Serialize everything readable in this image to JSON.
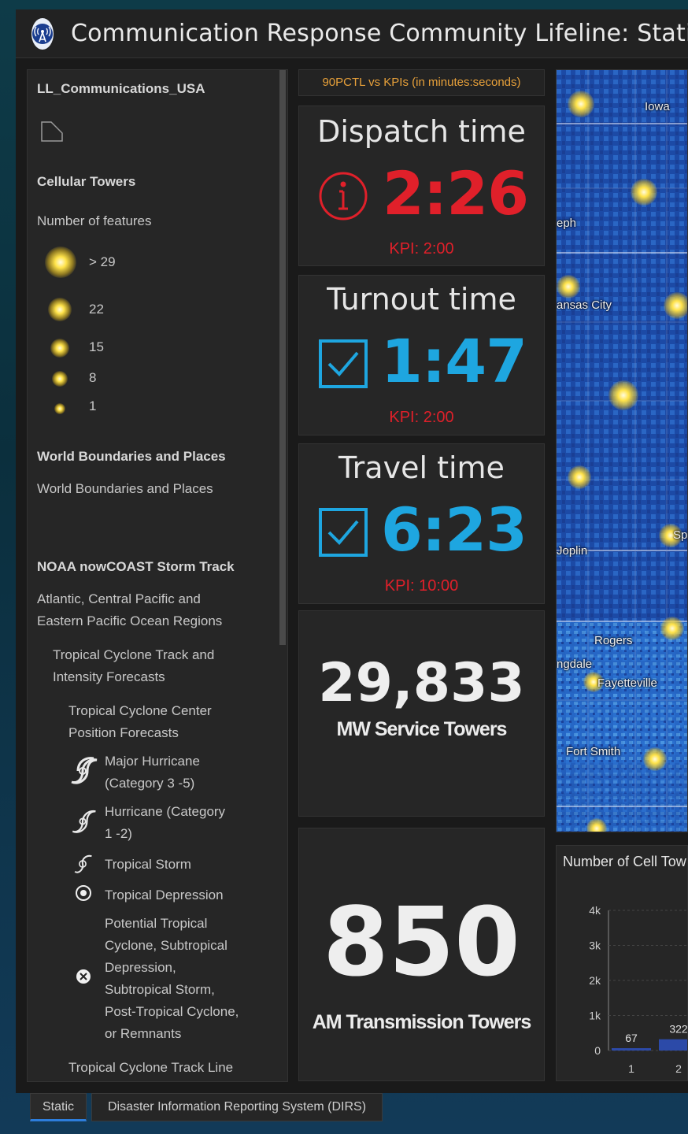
{
  "header": {
    "title": "Communication Response Community Lifeline: Static",
    "logo_icon": "radio-tower-icon"
  },
  "legend": {
    "layer_title": "LL_Communications_USA",
    "cellular_title": "Cellular Towers",
    "feature_count_label": "Number of features",
    "sizes": [
      "> 29",
      "22",
      "15",
      "8",
      "1"
    ],
    "world_title": "World Boundaries and Places",
    "world_item": "World Boundaries and Places",
    "noaa_title": "NOAA nowCOAST Storm Track",
    "regions_line1": "Atlantic, Central Pacific and",
    "regions_line2": "Eastern Pacific Ocean Regions",
    "forecasts_line1": "Tropical Cyclone Track and",
    "forecasts_line2": "Intensity Forecasts",
    "center_line1": "Tropical Cyclone Center",
    "center_line2": "Position Forecasts",
    "major_line1": "Major Hurricane",
    "major_line2": "(Category 3 -5)",
    "hurricane_line1": "Hurricane (Category",
    "hurricane_line2": "1 -2)",
    "storm": "Tropical Storm",
    "depression": "Tropical Depression",
    "potential_lines": [
      "Potential Tropical",
      "Cyclone, Subtropical",
      "Depression,",
      "Subtropical Storm,",
      "Post-Tropical Cyclone,",
      "or Remnants"
    ],
    "track_line": "Tropical Cyclone Track Line"
  },
  "kpi_note": "90PCTL vs KPIs (in minutes:seconds)",
  "cards": {
    "dispatch": {
      "title": "Dispatch time",
      "value": "2:26",
      "kpi": "KPI: 2:00",
      "icon": "info-circle-icon"
    },
    "turnout": {
      "title": "Turnout time",
      "value": "1:47",
      "kpi": "KPI: 2:00",
      "icon": "checkbox-checked-icon"
    },
    "travel": {
      "title": "Travel time",
      "value": "6:23",
      "kpi": "KPI: 10:00",
      "icon": "checkbox-checked-icon"
    },
    "mw": {
      "value": "29,833",
      "label": "MW Service Towers"
    },
    "am": {
      "value": "850",
      "label": "AM Transmission Towers"
    }
  },
  "colors": {
    "alert_red": "#e0202a",
    "ok_blue": "#1ea6e0",
    "kpi_orange": "#e8a13a",
    "active_tab": "#2d7ddb"
  },
  "map": {
    "labels": [
      "Iowa",
      "eph",
      "ansas City",
      "Joplin",
      "Sp",
      "Rogers",
      "ngdale",
      "Fayetteville",
      "Fort Smith"
    ]
  },
  "chart": {
    "title": "Number of Cell Tow",
    "y_ticks": [
      "4k",
      "3k",
      "2k",
      "1k",
      "0"
    ],
    "x_ticks": [
      "1",
      "2"
    ],
    "data_labels": [
      "67",
      "322"
    ]
  },
  "chart_data": {
    "type": "bar",
    "title": "Number of Cell Tow",
    "categories": [
      "1",
      "2"
    ],
    "values": [
      67,
      322
    ],
    "ylim": [
      0,
      4000
    ]
  },
  "tabs": [
    "Static",
    "Disaster Information Reporting System (DIRS)"
  ]
}
